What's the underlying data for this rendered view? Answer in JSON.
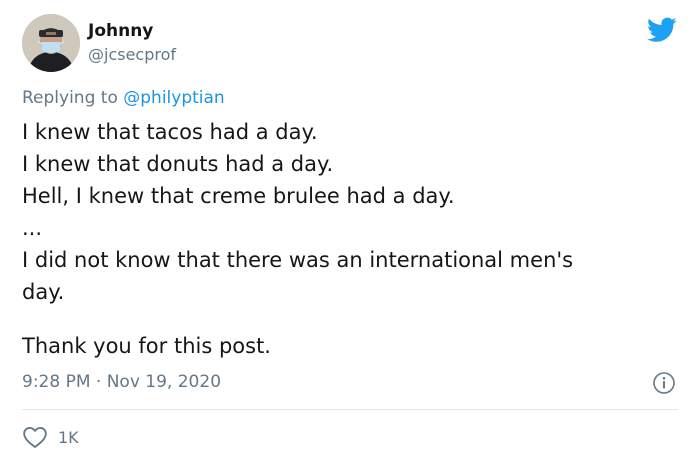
{
  "author": {
    "name": "Johnny",
    "handle": "@jcsecprof"
  },
  "reply": {
    "prefix": "Replying to",
    "mention": "@philyptian"
  },
  "body_lines": [
    "I knew that tacos had a day.",
    "I knew that donuts had a day.",
    "Hell, I knew that creme brulee had a day.",
    "...",
    "I did not know that there was an international men's",
    "day.",
    "",
    "Thank you for this post."
  ],
  "meta": {
    "time": "9:28 PM",
    "separator": "·",
    "date": "Nov 19, 2020"
  },
  "engagement": {
    "likes": "1K"
  },
  "icons": {
    "brand": "twitter-bird-icon",
    "info": "info-icon",
    "like": "heart-icon"
  },
  "colors": {
    "brand": "#1da1f2",
    "mention": "#1b95e0",
    "secondary_text": "#657786",
    "primary_text": "#14171a",
    "divider": "#e1e8ed"
  }
}
